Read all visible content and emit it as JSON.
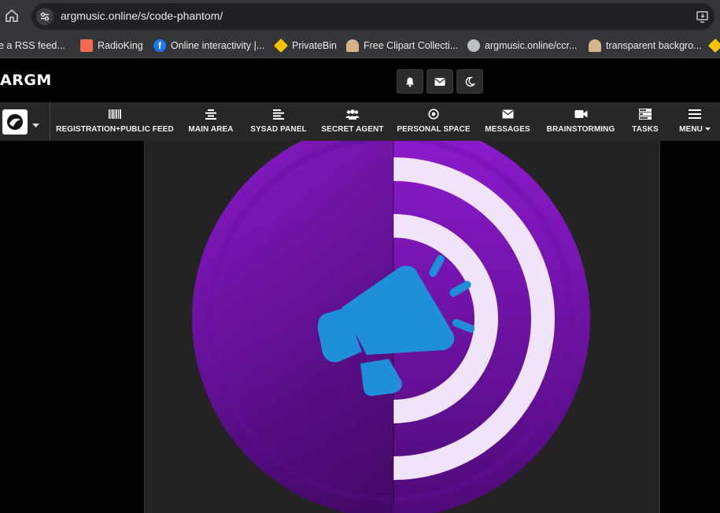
{
  "browser": {
    "url": "argmusic.online/s/code-phantom/",
    "bookmarks": [
      {
        "label": "e a RSS feed...",
        "icon": "rss-page-icon",
        "color": "#e8eaed"
      },
      {
        "label": "RadioKing",
        "icon": "radioking-icon",
        "color": "#f26b4e"
      },
      {
        "label": "Online interactivity |...",
        "icon": "facebook-icon",
        "color": "#1877f2"
      },
      {
        "label": "PrivateBin",
        "icon": "privatebin-icon",
        "color": "#f5c400"
      },
      {
        "label": "Free Clipart Collecti...",
        "icon": "clipart-person-icon",
        "color": "#d9b38c"
      },
      {
        "label": "argmusic.online/ccr...",
        "icon": "globe-icon",
        "color": "#bdc1c6"
      },
      {
        "label": "transparent backgro...",
        "icon": "clipart-person-icon",
        "color": "#d9b38c"
      },
      {
        "label": "",
        "icon": "privatebin-icon",
        "color": "#f5c400"
      }
    ]
  },
  "site": {
    "logo_text": "ARGM",
    "header_buttons": [
      {
        "name": "notifications-button",
        "icon": "bell-icon"
      },
      {
        "name": "messages-button",
        "icon": "envelope-icon"
      },
      {
        "name": "dark-mode-button",
        "icon": "moon-icon"
      }
    ]
  },
  "nav": {
    "items": [
      {
        "label": "REGISTRATION+PUBLIC FEED",
        "icon": "barcode-icon"
      },
      {
        "label": "MAIN AREA",
        "icon": "align-center-icon"
      },
      {
        "label": "SYSAD PANEL",
        "icon": "align-left-icon"
      },
      {
        "label": "SECRET AGENT",
        "icon": "users-icon"
      },
      {
        "label": "PERSONAL SPACE",
        "icon": "dot-circle-icon"
      },
      {
        "label": "MESSAGES",
        "icon": "envelope-icon"
      },
      {
        "label": "BRAINSTORMING",
        "icon": "video-camera-icon"
      },
      {
        "label": "TASKS",
        "icon": "tasks-icon"
      },
      {
        "label": "MENU",
        "icon": "hamburger-icon"
      }
    ]
  },
  "hero": {
    "image": "megaphone-broadcast-icon",
    "circle_color_top": "#8e1bd0",
    "circle_color_bottom": "#4e0a78",
    "ring_color": "#f0e4fb",
    "megaphone_color": "#1e8fd8"
  },
  "colors": {
    "page_bg": "#000000",
    "chrome_bg": "#35363a",
    "nav_bg": "#272727",
    "panel_bg": "#232323"
  }
}
